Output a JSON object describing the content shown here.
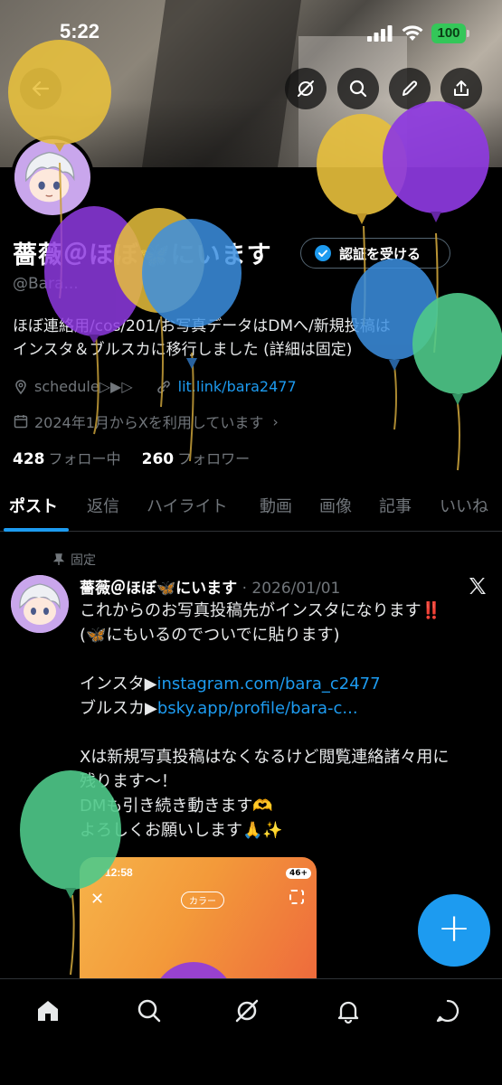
{
  "status_bar": {
    "time": "5:22",
    "battery": "100"
  },
  "profile": {
    "name": "薔薇＠ほぼ🦋にいます",
    "handle": "@Bara...",
    "verify_button": "認証を受ける",
    "bio_lines": [
      "ほぼ連絡用/cos/201/お写真データはDMへ/新規投稿は",
      "インスタ＆ブルスカに移行しました (詳細は固定)"
    ],
    "location": "schedule▷▶▷",
    "website": "lit.link/bara2477",
    "joined": "2024年1月からXを利用しています",
    "following_count": "428",
    "following_label": "フォロー中",
    "followers_count": "260",
    "followers_label": "フォロワー"
  },
  "tabs": [
    "ポスト",
    "返信",
    "ハイライト",
    "動画",
    "画像",
    "記事",
    "いいね"
  ],
  "post": {
    "pinned_label": "固定",
    "author": "薔薇＠ほぼ🦋にいます",
    "date": "· 2026/01/01",
    "lines": [
      "これからのお写真投稿先がインスタになります‼️",
      "(🦋にもいるのでついでに貼ります)",
      "",
      "インスタ▶",
      "ブルスカ▶",
      "",
      "Xは新規写真投稿はなくなるけど閲覧連絡諸々用に",
      "残ります〜！",
      "DMも引き続き動きます🫶",
      "よろしくお願いします🙏✨"
    ],
    "instagram_link": "instagram.com/bara_c2477",
    "bluesky_link": "bsky.app/profile/bara-c...",
    "media": {
      "time": "12:58",
      "badge": "46+",
      "pill": "カラー"
    }
  },
  "fab_label": "+",
  "colors": {
    "accent": "#1d9bf0",
    "background": "#000000",
    "muted": "#71767b"
  }
}
